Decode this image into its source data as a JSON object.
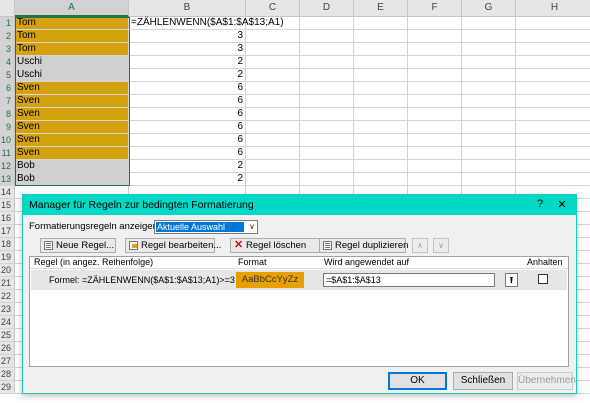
{
  "sheet": {
    "columns": [
      "A",
      "B",
      "C",
      "D",
      "E",
      "F",
      "G",
      "H"
    ],
    "rows": [
      {
        "n": "1",
        "a": "Tom",
        "b": "=ZÄHLENWENN($A$1:$A$13;A1)",
        "hl": "#d4a20e"
      },
      {
        "n": "2",
        "a": "Tom",
        "b": "3",
        "hl": "#d4a20e"
      },
      {
        "n": "3",
        "a": "Tom",
        "b": "3",
        "hl": "#d4a20e"
      },
      {
        "n": "4",
        "a": "Uschi",
        "b": "2",
        "hl": "#d0d0d0"
      },
      {
        "n": "5",
        "a": "Uschi",
        "b": "2",
        "hl": "#d0d0d0"
      },
      {
        "n": "6",
        "a": "Sven",
        "b": "6",
        "hl": "#d4a20e"
      },
      {
        "n": "7",
        "a": "Sven",
        "b": "6",
        "hl": "#d4a20e"
      },
      {
        "n": "8",
        "a": "Sven",
        "b": "6",
        "hl": "#d4a20e"
      },
      {
        "n": "9",
        "a": "Sven",
        "b": "6",
        "hl": "#d4a20e"
      },
      {
        "n": "10",
        "a": "Sven",
        "b": "6",
        "hl": "#d4a20e"
      },
      {
        "n": "11",
        "a": "Sven",
        "b": "6",
        "hl": "#d4a20e"
      },
      {
        "n": "12",
        "a": "Bob",
        "b": "2",
        "hl": "#d0d0d0"
      },
      {
        "n": "13",
        "a": "Bob",
        "b": "2",
        "hl": "#d0d0d0"
      },
      {
        "n": "14",
        "a": "",
        "b": ""
      },
      {
        "n": "15",
        "a": "",
        "b": ""
      },
      {
        "n": "16",
        "a": "",
        "b": ""
      },
      {
        "n": "17",
        "a": "",
        "b": ""
      },
      {
        "n": "18",
        "a": "",
        "b": ""
      },
      {
        "n": "19",
        "a": "",
        "b": ""
      },
      {
        "n": "20",
        "a": "",
        "b": ""
      },
      {
        "n": "21",
        "a": "",
        "b": ""
      },
      {
        "n": "22",
        "a": "",
        "b": ""
      },
      {
        "n": "23",
        "a": "",
        "b": ""
      },
      {
        "n": "24",
        "a": "",
        "b": ""
      },
      {
        "n": "25",
        "a": "",
        "b": ""
      },
      {
        "n": "26",
        "a": "",
        "b": ""
      },
      {
        "n": "27",
        "a": "",
        "b": ""
      },
      {
        "n": "28",
        "a": "",
        "b": ""
      },
      {
        "n": "29",
        "a": "",
        "b": ""
      }
    ],
    "highlight_yellow": "#d4a20e",
    "highlight_gray": "#d0d0d0"
  },
  "dialog": {
    "title": "Manager für Regeln zur bedingten Formatierung",
    "help_label": "?",
    "close_label": "✕",
    "show_rules_label": "Formatierungsregeln anzeigen für:",
    "show_rules_value": "Aktuelle Auswahl",
    "toolbar": {
      "new_rule": "Neue Regel...",
      "edit_rule": "Regel bearbeiten...",
      "delete_rule": "Regel löschen",
      "duplicate_rule": "Regel duplizieren"
    },
    "columns": {
      "rule": "Regel (in angez. Reihenfolge)",
      "format": "Format",
      "applies_to": "Wird angewendet auf",
      "stop": "Anhalten"
    },
    "rule_row": {
      "rule": "Formel: =ZÄHLENWENN($A$1:$A$13;A1)>=3",
      "format_preview": "AaBbCcYyZz",
      "applies_to": "=$A$1:$A$13",
      "stop_checked": false
    },
    "accent_color": "#00d9c6",
    "ok_label": "OK",
    "close_button_label": "Schließen",
    "apply_label": "Übernehmen"
  }
}
